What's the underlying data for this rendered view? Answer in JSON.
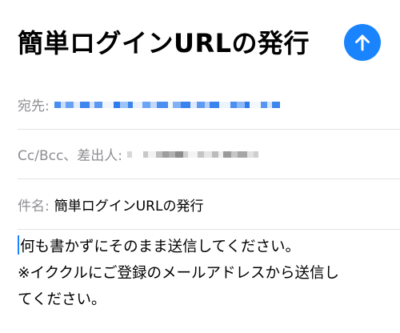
{
  "compose": {
    "title": "簡単ログインURLの発行",
    "send_icon": "arrow-up-icon",
    "accent": "#1a84ff"
  },
  "fields": {
    "to_label": "宛先:",
    "cc_label": "Cc/Bcc、差出人:",
    "subject_label": "件名:",
    "subject_value": "簡単ログインURLの発行"
  },
  "body": {
    "line1": "何も書かずにそのまま送信してください。",
    "line2": "※イククルにご登録のメールアドレスから送信し",
    "line3": "てください。"
  }
}
